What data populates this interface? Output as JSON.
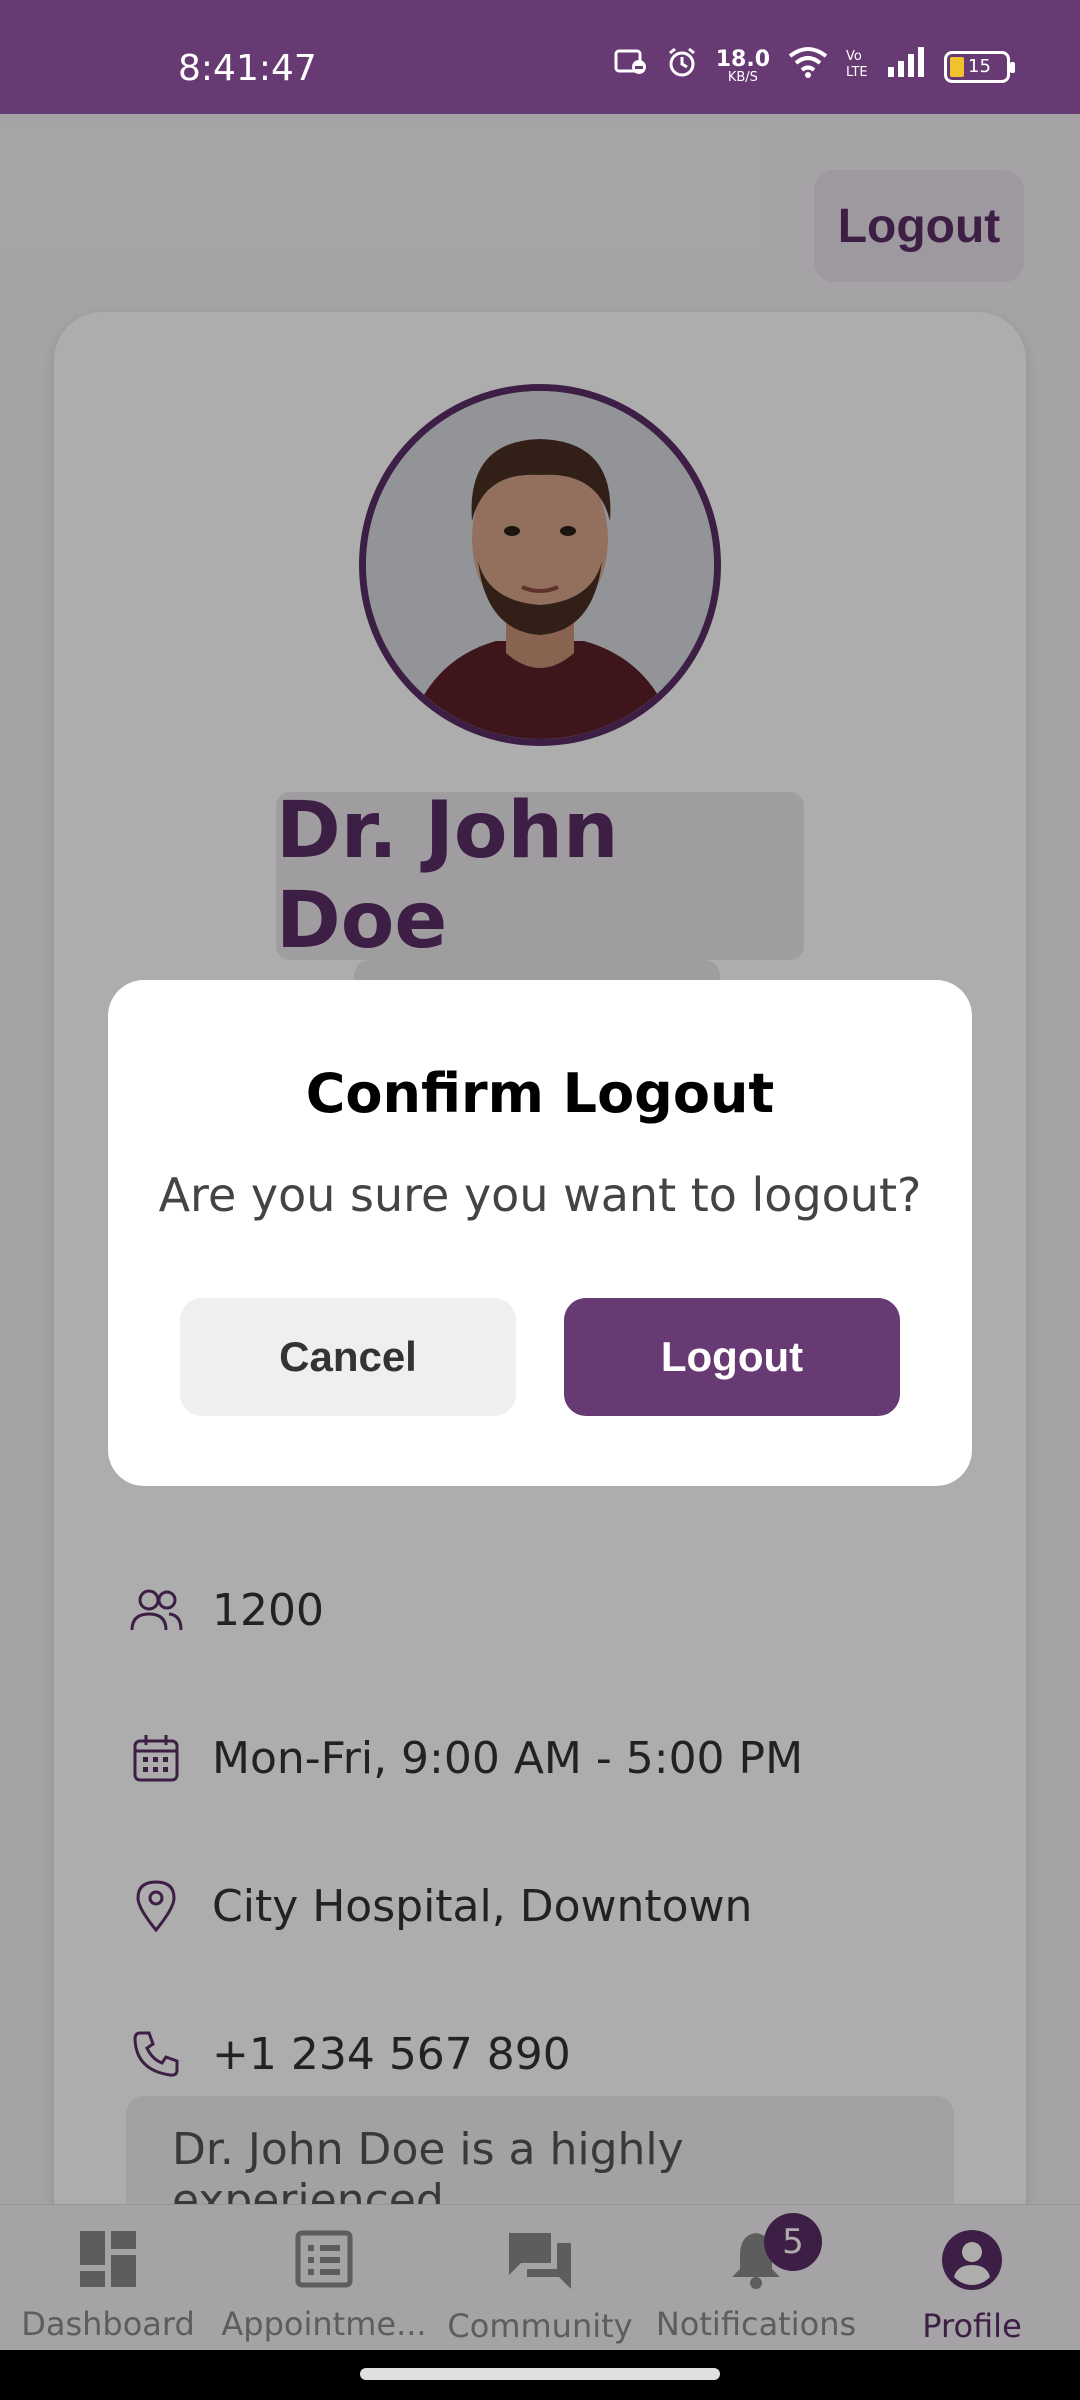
{
  "status_bar": {
    "time": "8:41:47",
    "speed_value": "18.0",
    "speed_unit": "KB/S",
    "battery": "15"
  },
  "header": {
    "logout_label": "Logout"
  },
  "profile": {
    "name": "Dr. John Doe",
    "patients": "1200",
    "hours": "Mon-Fri, 9:00 AM - 5:00 PM",
    "location": "City Hospital, Downtown",
    "phone": "+1 234 567 890",
    "about": "Dr. John Doe is a highly experienced"
  },
  "dialog": {
    "title": "Confirm Logout",
    "message": "Are you sure you want to logout?",
    "cancel_label": "Cancel",
    "confirm_label": "Logout"
  },
  "bottom_nav": {
    "items": [
      {
        "label": "Dashboard",
        "icon": "dashboard-icon"
      },
      {
        "label": "Appointme...",
        "icon": "appointments-icon"
      },
      {
        "label": "Community",
        "icon": "community-icon"
      },
      {
        "label": "Notifications",
        "icon": "bell-icon",
        "badge": "5"
      },
      {
        "label": "Profile",
        "icon": "profile-icon"
      }
    ],
    "active": "Profile"
  },
  "colors": {
    "primary": "#683a73",
    "primary_dark": "#5b2d66"
  }
}
